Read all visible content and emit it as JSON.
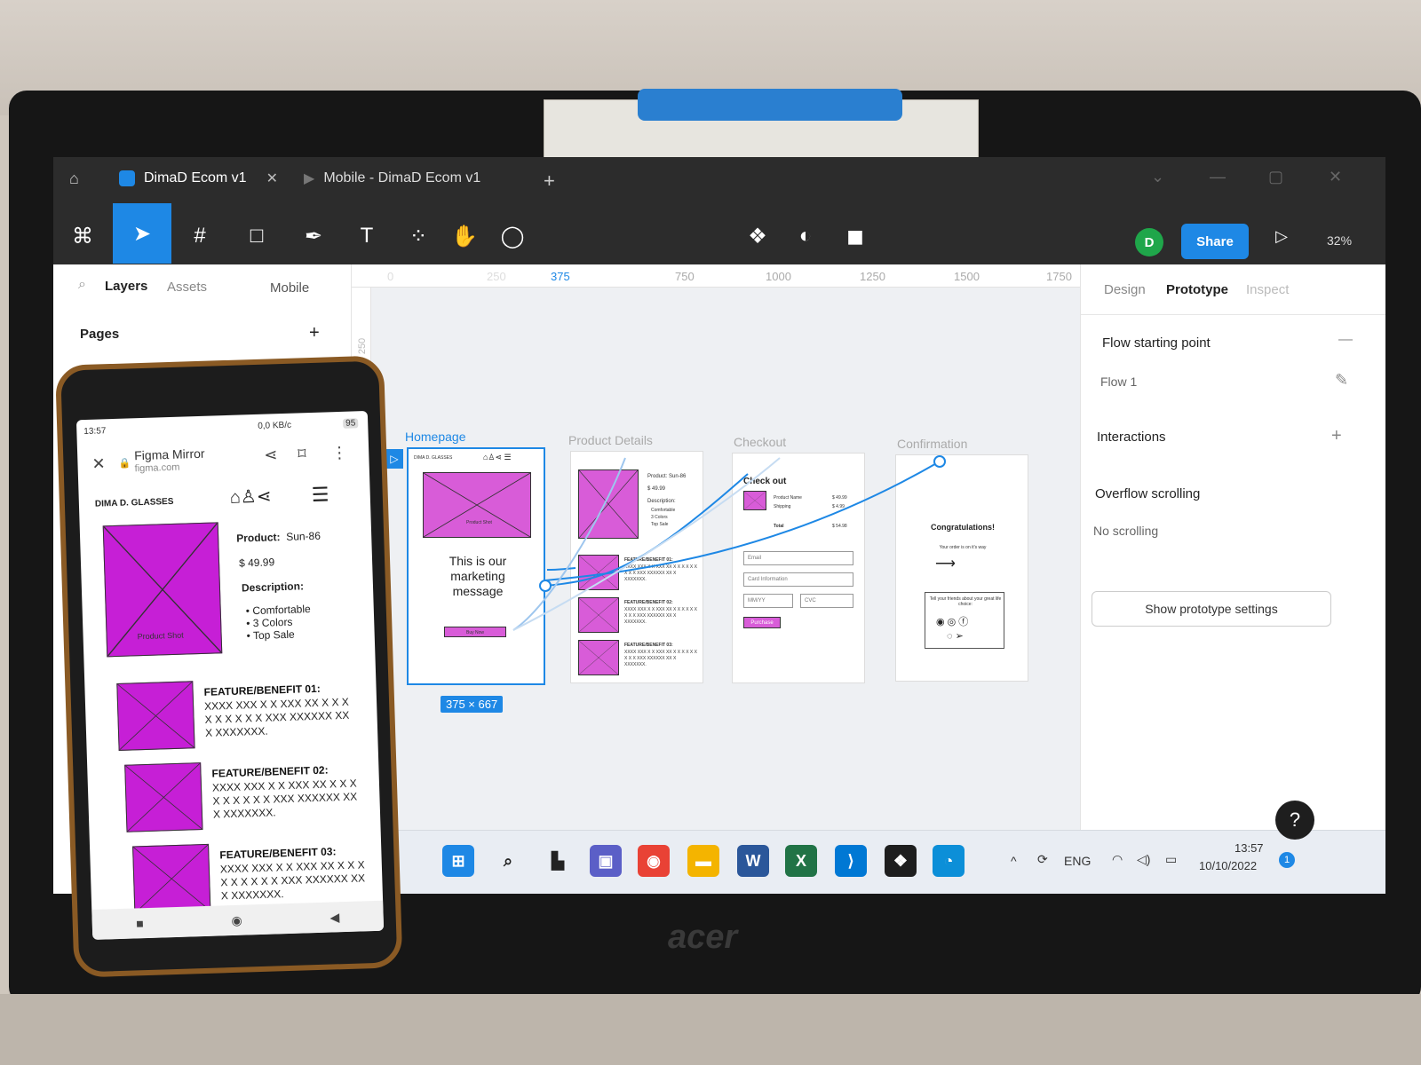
{
  "tabs": [
    {
      "label": "DimaD Ecom v1",
      "active": true
    },
    {
      "label": "Mobile - DimaD Ecom v1",
      "active": false
    }
  ],
  "toolbar": {
    "share": "Share",
    "zoom": "32%",
    "avatar": "D"
  },
  "left_panel": {
    "layers": "Layers",
    "assets": "Assets",
    "page_selector": "Mobile",
    "pages": "Pages"
  },
  "ruler": {
    "ticks": [
      "0",
      "250",
      "375",
      "750",
      "1000",
      "1250",
      "1500",
      "1750"
    ],
    "left": "250"
  },
  "frames": {
    "homepage": {
      "label": "Homepage",
      "brand": "DIMA D. GLASSES",
      "photo": "Product Shot",
      "message": "This is our marketing message",
      "button": "Buy Now",
      "size": "375 × 667"
    },
    "product": {
      "label": "Product Details",
      "product": "Product: Sun-86",
      "price": "$ 49.99",
      "desc": "Description:",
      "bullets": [
        "Comfortable",
        "3 Colors",
        "Top Sale"
      ],
      "features": [
        "FEATURE/BENEFIT 01:",
        "FEATURE/BENEFIT 02:",
        "FEATURE/BENEFIT 03:"
      ],
      "feature_text": "XXXX XXX X X XXX XX X X X X X X X X X XXX XXXXXX XX X XXXXXXX."
    },
    "checkout": {
      "label": "Checkout",
      "title": "Check out",
      "item": "Product Name",
      "item_price": "$ 49.99",
      "shipping": "Shipping",
      "ship_price": "$ 4.99",
      "total": "Total",
      "total_price": "$ 54.98",
      "email": "Email",
      "card": "Card Information",
      "mmyy": "MM/YY",
      "cvc": "CVC",
      "purchase": "Purchase"
    },
    "confirmation": {
      "label": "Confirmation",
      "title": "Congratulations!",
      "sub": "Your order is on it's way",
      "share": "Tell your friends about your great life choice:"
    }
  },
  "right_panel": {
    "tabs": [
      "Design",
      "Prototype",
      "Inspect"
    ],
    "flow_start": "Flow starting point",
    "flow": "Flow 1",
    "interactions": "Interactions",
    "overflow": "Overflow scrolling",
    "no_scroll": "No scrolling",
    "settings_btn": "Show prototype settings"
  },
  "taskbar": {
    "lang": "ENG",
    "time": "13:57",
    "date": "10/10/2022"
  },
  "phone": {
    "time": "13:57",
    "net": "0,0 KB/c",
    "battery": "95",
    "app_title": "Figma Mirror",
    "app_url": "figma.com",
    "brand": "DIMA D. GLASSES",
    "photo": "Product Shot",
    "product_label": "Product:",
    "product": "Sun-86",
    "price": "$ 49.99",
    "desc": "Description:",
    "bullets": [
      "Comfortable",
      "3 Colors",
      "Top Sale"
    ],
    "features": [
      "FEATURE/BENEFIT 01:",
      "FEATURE/BENEFIT 02:",
      "FEATURE/BENEFIT 03:"
    ],
    "feature_text": "XXXX XXX X X XXX XX X X X X X X X X X XXX XXXXXX XX X XXXXXXX."
  },
  "laptop_brand": "acer",
  "colors": {
    "accent": "#1e88e5",
    "placeholder": "#d85cd8",
    "toolbar": "#2c2c2c"
  }
}
